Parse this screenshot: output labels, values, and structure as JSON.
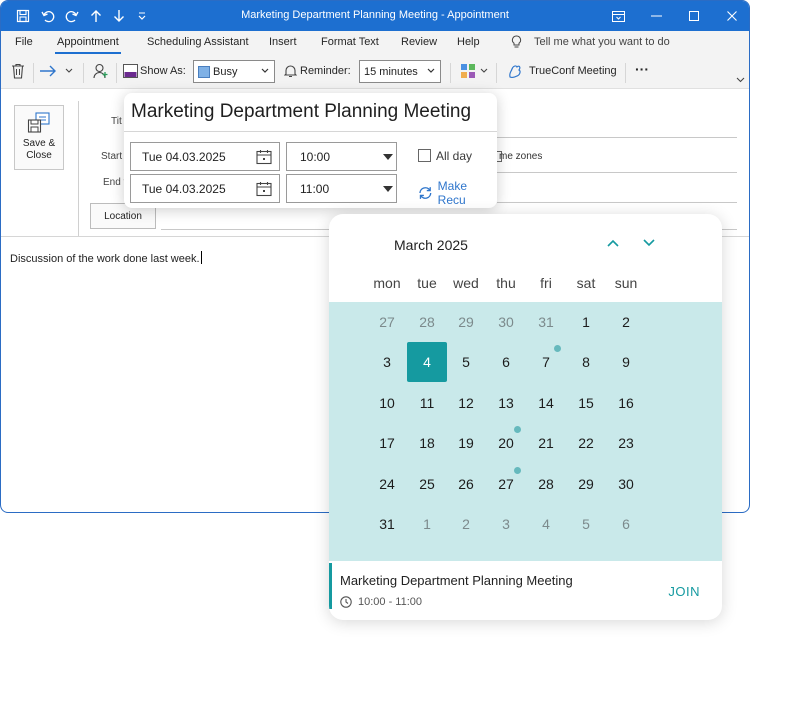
{
  "window": {
    "title": "Marketing Department Planning Meeting  -  Appointment"
  },
  "menu": {
    "tabs": [
      "File",
      "Appointment",
      "Scheduling Assistant",
      "Insert",
      "Format Text",
      "Review",
      "Help"
    ],
    "active": "Appointment",
    "tell_me": "Tell me what you want to do"
  },
  "ribbon": {
    "show_as_label": "Show As:",
    "show_as_value": "Busy",
    "reminder_label": "Reminder:",
    "reminder_value": "15 minutes",
    "trueconf_label": "TrueConf Meeting",
    "more": "···"
  },
  "form": {
    "save_close_line1": "Save &",
    "save_close_line2": "Close",
    "title_label": "Tit",
    "start_label": "Start",
    "end_label": "End t",
    "location_button": "Location",
    "body_text": "Discussion of the work done last week.",
    "time_zones_text": "me zones"
  },
  "appointment_popup": {
    "title": "Marketing Department Planning Meeting",
    "start_date": "Tue 04.03.2025",
    "start_time": "10:00",
    "end_date": "Tue 04.03.2025",
    "end_time": "11:00",
    "all_day_label": "All day",
    "make_recurring_label": "Make Recu"
  },
  "calendar": {
    "month_label": "March 2025",
    "weekdays": [
      "mon",
      "tue",
      "wed",
      "thu",
      "fri",
      "sat",
      "sun"
    ],
    "weeks": [
      [
        {
          "d": "27",
          "m": true
        },
        {
          "d": "28",
          "m": true
        },
        {
          "d": "29",
          "m": true
        },
        {
          "d": "30",
          "m": true
        },
        {
          "d": "31",
          "m": true
        },
        {
          "d": "1"
        },
        {
          "d": "2"
        }
      ],
      [
        {
          "d": "3"
        },
        {
          "d": "4",
          "sel": true
        },
        {
          "d": "5"
        },
        {
          "d": "6"
        },
        {
          "d": "7",
          "dot": true
        },
        {
          "d": "8"
        },
        {
          "d": "9"
        }
      ],
      [
        {
          "d": "10"
        },
        {
          "d": "11"
        },
        {
          "d": "12"
        },
        {
          "d": "13"
        },
        {
          "d": "14"
        },
        {
          "d": "15"
        },
        {
          "d": "16"
        }
      ],
      [
        {
          "d": "17"
        },
        {
          "d": "18"
        },
        {
          "d": "19"
        },
        {
          "d": "20",
          "dot": true
        },
        {
          "d": "21"
        },
        {
          "d": "22"
        },
        {
          "d": "23"
        }
      ],
      [
        {
          "d": "24"
        },
        {
          "d": "25"
        },
        {
          "d": "26"
        },
        {
          "d": "27",
          "dot": true
        },
        {
          "d": "28"
        },
        {
          "d": "29"
        },
        {
          "d": "30"
        }
      ],
      [
        {
          "d": "31"
        },
        {
          "d": "1",
          "m": true
        },
        {
          "d": "2",
          "m": true
        },
        {
          "d": "3",
          "m": true
        },
        {
          "d": "4",
          "m": true
        },
        {
          "d": "5",
          "m": true
        },
        {
          "d": "6",
          "m": true
        }
      ]
    ],
    "event": {
      "title": "Marketing Department Planning Meeting",
      "time": "10:00 - 11:00",
      "join_label": "JOIN"
    }
  },
  "colors": {
    "titlebar": "#1d6fd0",
    "accent_teal": "#159aa0",
    "grid_bg": "#c9e9ea",
    "link_blue": "#2f76cc"
  }
}
